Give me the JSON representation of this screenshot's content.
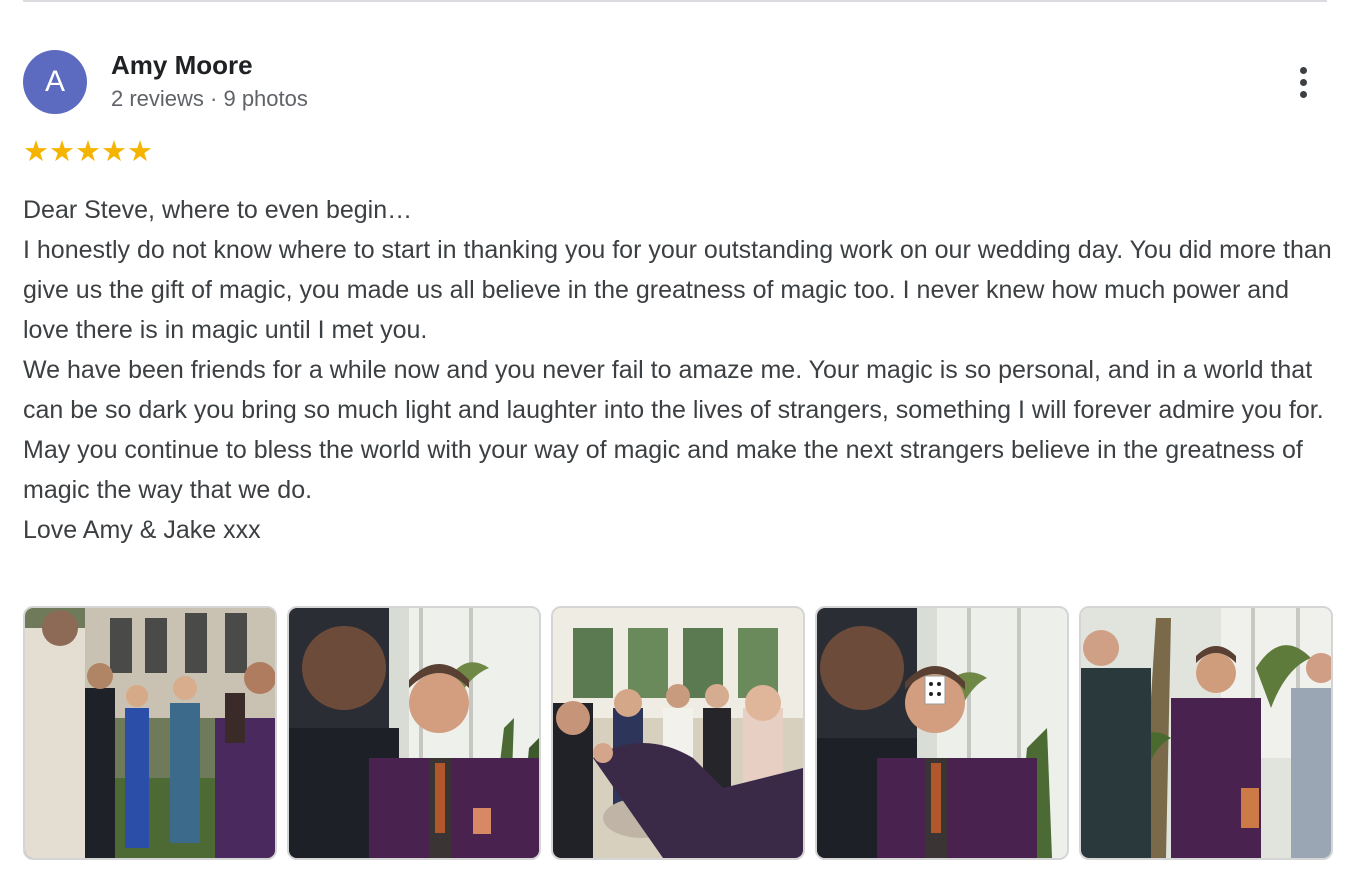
{
  "reviewer": {
    "initial": "A",
    "name": "Amy Moore",
    "meta": "2 reviews · 9 photos",
    "avatar_color": "#5c6bc0"
  },
  "rating": {
    "stars": 5,
    "star_display": "★★★★★",
    "star_color": "#f4b400"
  },
  "more_options_icon": "more-vert-icon",
  "review_paragraphs": [
    "Dear Steve, where to even begin…",
    "I honestly do not know where to start in thanking you for your outstanding work on our wedding day. You did more than give us the gift of magic, you made us all believe in the greatness of magic too. I never knew how much power and love there is in magic until I met you.",
    "We have been friends for a while now and you never fail to amaze me. Your magic is so personal, and in a world that can be so dark you bring so much light and laughter into the lives of strangers, something I will forever admire you for.",
    "May you continue to bless the world with your way of magic and make the next strangers believe in the greatness of magic the way that we do.",
    "Love Amy & Jake xxx"
  ],
  "photos_count": 5
}
